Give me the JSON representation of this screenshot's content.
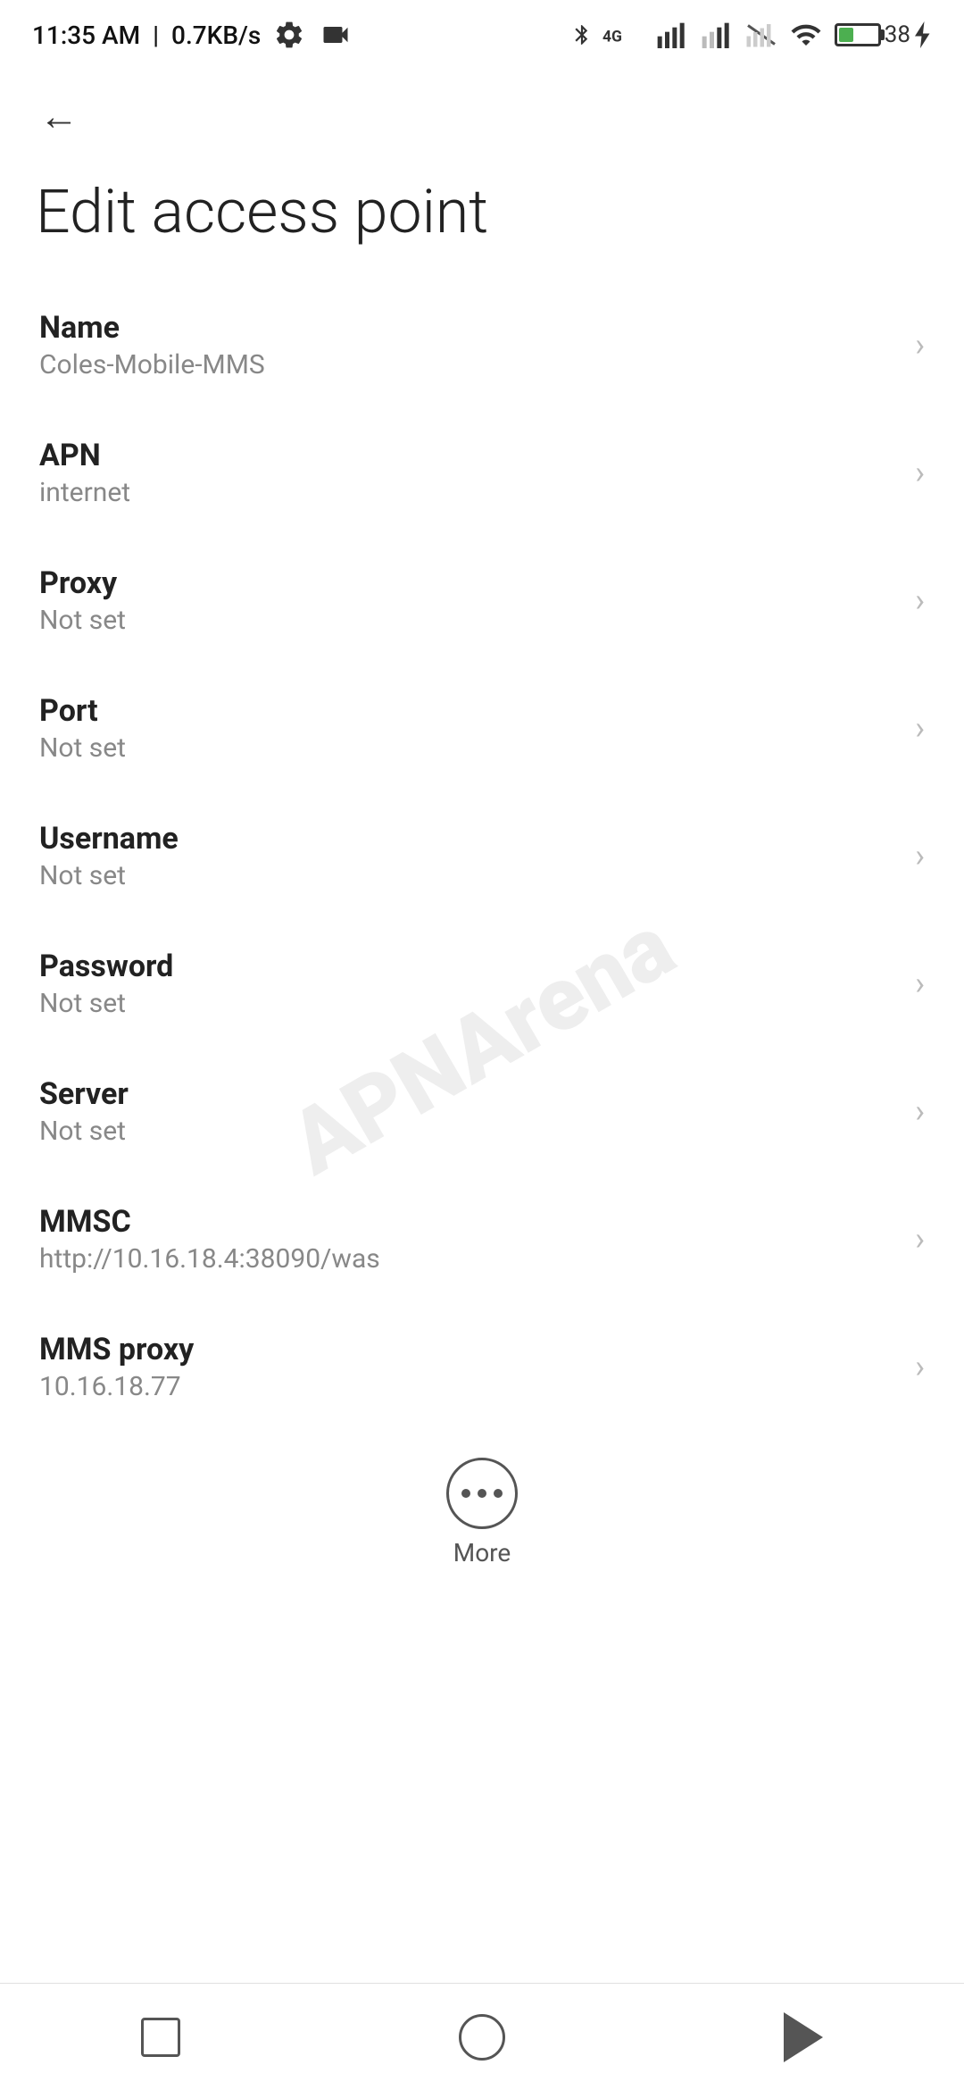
{
  "statusBar": {
    "time": "11:35 AM",
    "speed": "0.7KB/s",
    "battery": "38"
  },
  "toolbar": {
    "backLabel": "←"
  },
  "page": {
    "title": "Edit access point"
  },
  "settings": [
    {
      "label": "Name",
      "value": "Coles-Mobile-MMS"
    },
    {
      "label": "APN",
      "value": "internet"
    },
    {
      "label": "Proxy",
      "value": "Not set"
    },
    {
      "label": "Port",
      "value": "Not set"
    },
    {
      "label": "Username",
      "value": "Not set"
    },
    {
      "label": "Password",
      "value": "Not set"
    },
    {
      "label": "Server",
      "value": "Not set"
    },
    {
      "label": "MMSC",
      "value": "http://10.16.18.4:38090/was"
    },
    {
      "label": "MMS proxy",
      "value": "10.16.18.77"
    }
  ],
  "more": {
    "label": "More"
  },
  "watermark": "APNArena"
}
